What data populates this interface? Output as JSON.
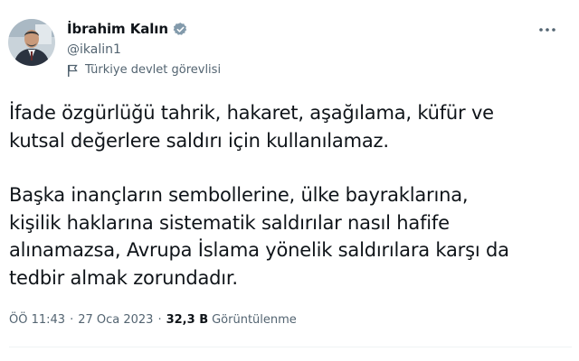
{
  "author": {
    "display_name": "İbrahim Kalın",
    "handle": "@ikalin1",
    "label": "Türkiye devlet görevlisi"
  },
  "tweet": {
    "paragraph_1": "İfade özgürlüğü tahrik, hakaret, aşağılama, küfür ve\nkutsal değerlere saldırı için kullanılamaz.",
    "paragraph_2": "Başka inançların sembollerine, ülke bayraklarına,\nkişilik haklarına sistematik saldırılar nasıl hafife\nalınamazsa, Avrupa İslama yönelik saldırılara karşı da\ntedbir almak zorundadır.",
    "time": "ÖÖ 11:43",
    "date": "27 Oca 2023",
    "separator": "·",
    "views_count": "32,3 B",
    "views_label": "Görüntülenme"
  },
  "colors": {
    "verified_badge": "#829aab",
    "secondary_text": "#536471",
    "primary_text": "#0f1419"
  },
  "icons": {
    "verified": "verified-badge-icon",
    "label": "flag-icon",
    "more": "more-options-icon"
  }
}
